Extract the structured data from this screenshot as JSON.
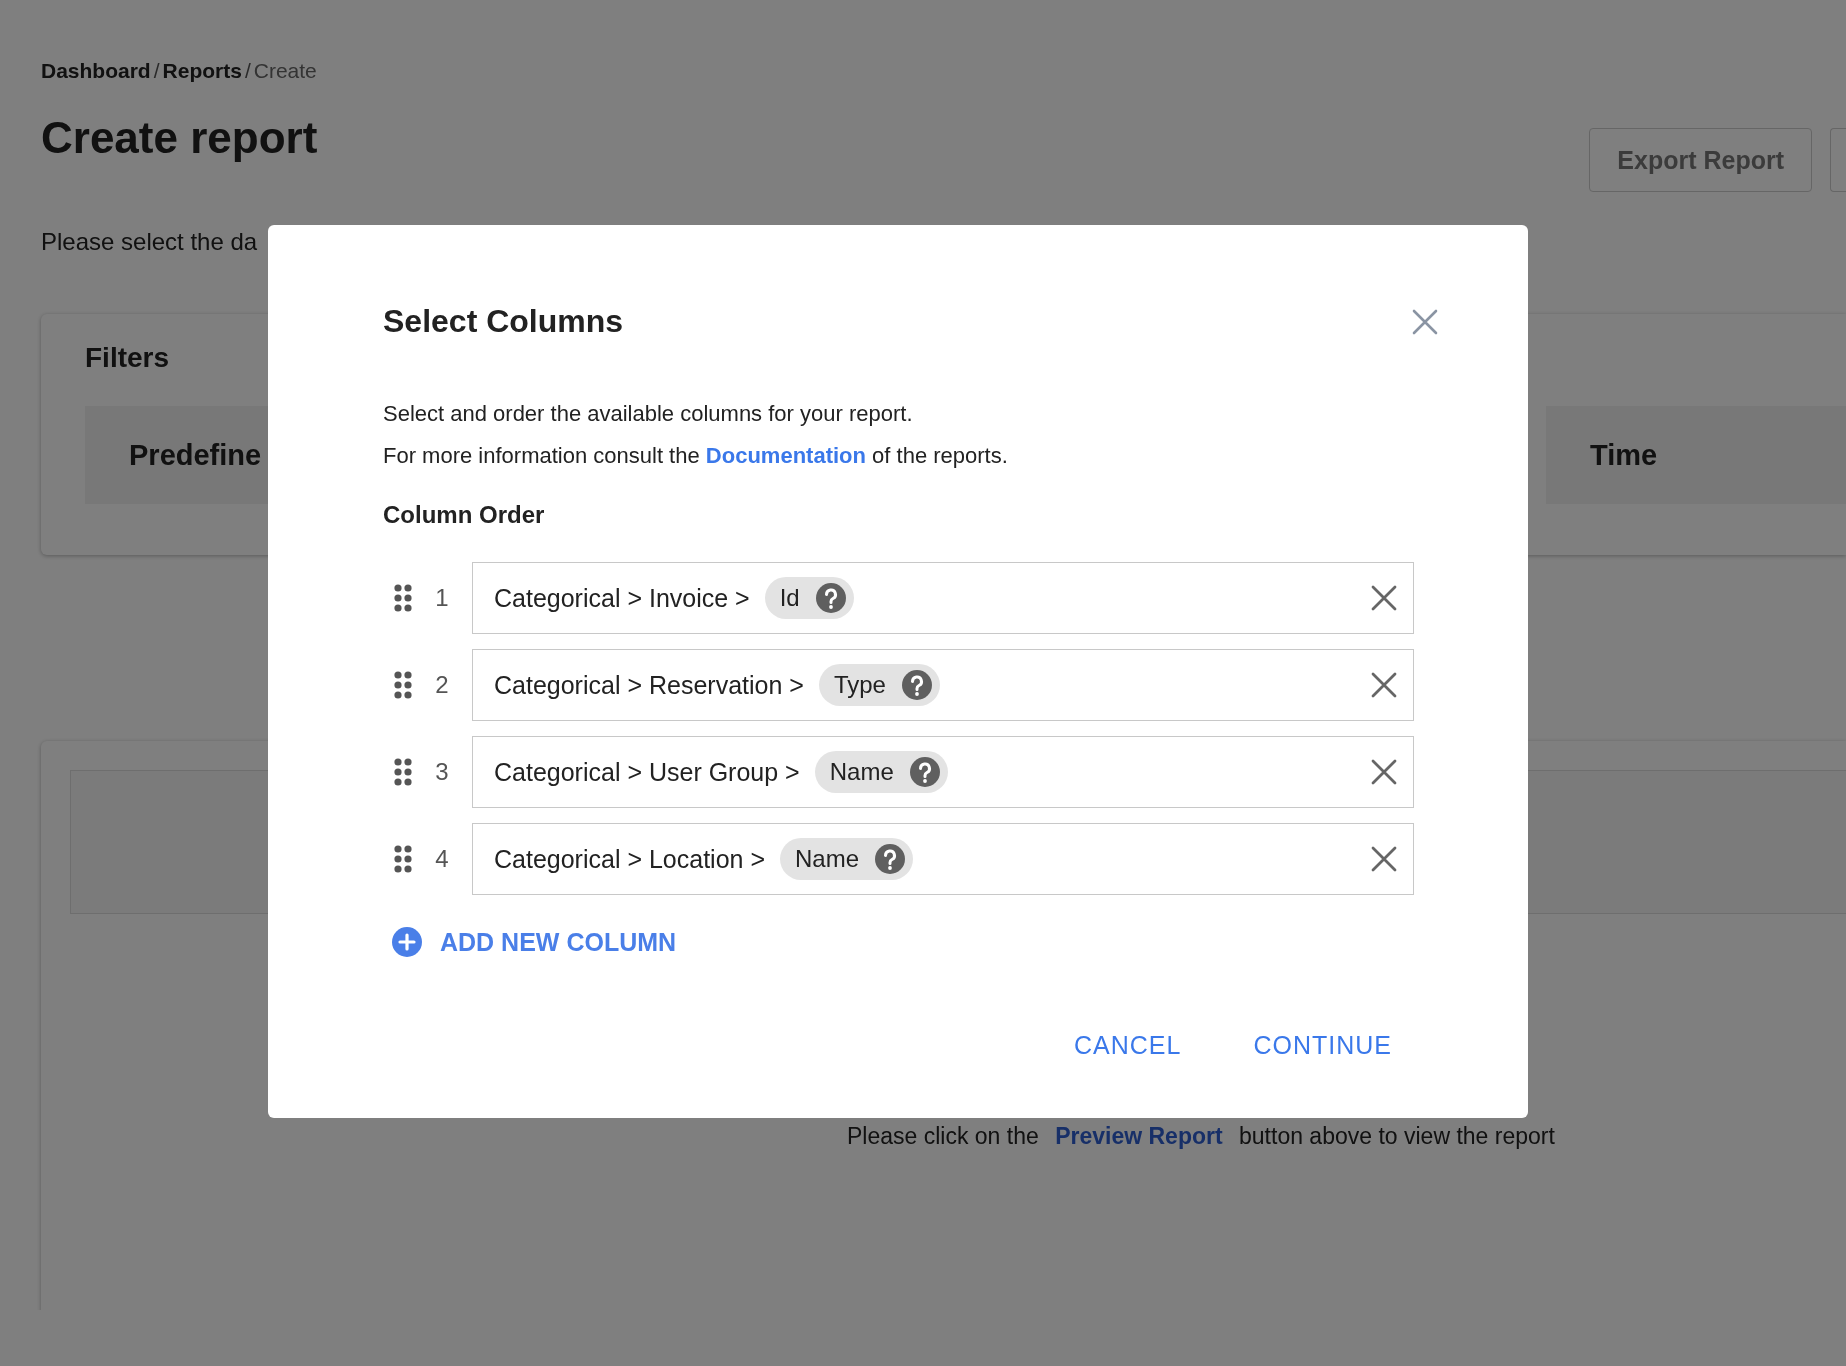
{
  "breadcrumb": [
    {
      "label": "Dashboard",
      "current": false
    },
    {
      "separator": "/"
    },
    {
      "label": "Reports",
      "current": false
    },
    {
      "separator": "/"
    },
    {
      "label": "Create",
      "current": true
    }
  ],
  "page": {
    "title": "Create report",
    "header_buttons": [
      "Export Report"
    ],
    "intro": "Please select the da"
  },
  "filters": {
    "title": "Filters",
    "panels": [
      "Predefine",
      "Time"
    ]
  },
  "report_area": {
    "message_before": "Please click on the",
    "link": "Preview Report",
    "message_after": "button above to view the report"
  },
  "dialog": {
    "title": "Select Columns",
    "description": "Select and order the available columns for your report.",
    "info_before": "For more information consult the",
    "info_link": "Documentation",
    "info_after": "of the reports.",
    "section_title": "Column Order",
    "columns": [
      {
        "number": "1",
        "path": "Categorical > Invoice >",
        "field": "Id"
      },
      {
        "number": "2",
        "path": "Categorical > Reservation >",
        "field": "Type"
      },
      {
        "number": "3",
        "path": "Categorical > User Group >",
        "field": "Name"
      },
      {
        "number": "4",
        "path": "Categorical > Location >",
        "field": "Name"
      }
    ],
    "add_button": "ADD NEW COLUMN",
    "buttons": [
      "CANCEL",
      "CONTINUE"
    ]
  }
}
